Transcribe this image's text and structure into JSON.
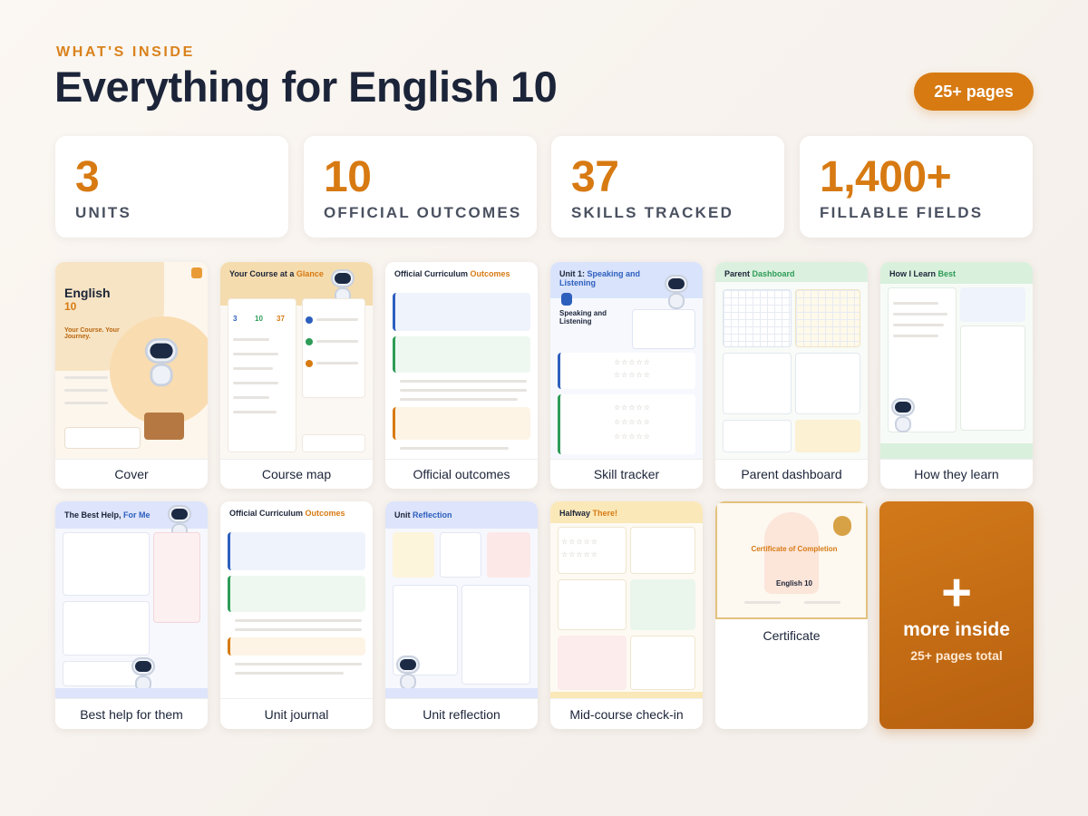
{
  "header": {
    "eyebrow": "WHAT'S INSIDE",
    "title": "Everything for English 10",
    "pages_badge": "25+ pages"
  },
  "stats": [
    {
      "value": "3",
      "label": "UNITS"
    },
    {
      "value": "10",
      "label": "OFFICIAL OUTCOMES"
    },
    {
      "value": "37",
      "label": "SKILLS TRACKED"
    },
    {
      "value": "1,400+",
      "label": "FILLABLE FIELDS"
    }
  ],
  "pages": [
    {
      "caption": "Cover",
      "preview": {
        "title": "English",
        "subtitle": "10",
        "tagline": "Your Course. Your Journey."
      }
    },
    {
      "caption": "Course map",
      "preview": {
        "title": "Your Course at a",
        "accent": "Glance",
        "nums": [
          "3",
          "10",
          "37"
        ]
      }
    },
    {
      "caption": "Official outcomes",
      "preview": {
        "title": "Official Curriculum",
        "accent": "Outcomes"
      }
    },
    {
      "caption": "Skill tracker",
      "preview": {
        "title": "Unit 1:",
        "accent": "Speaking and Listening",
        "section": "Speaking and Listening"
      }
    },
    {
      "caption": "Parent dashboard",
      "preview": {
        "title": "Parent",
        "accent": "Dashboard"
      }
    },
    {
      "caption": "How they learn",
      "preview": {
        "title": "How I Learn",
        "accent": "Best"
      }
    },
    {
      "caption": "Best help for them",
      "preview": {
        "title": "The Best Help,",
        "accent": "For Me"
      }
    },
    {
      "caption": "Unit journal",
      "preview": {
        "title": "Official Curriculum",
        "accent": "Outcomes"
      }
    },
    {
      "caption": "Unit reflection",
      "preview": {
        "title": "Unit",
        "accent": "Reflection"
      }
    },
    {
      "caption": "Mid-course check-in",
      "preview": {
        "title": "Halfway",
        "accent": "There!"
      }
    },
    {
      "caption": "Certificate",
      "preview": {
        "title": "Certificate of Completion",
        "subtitle": "English 10"
      }
    }
  ],
  "more_card": {
    "plus": "+",
    "line1": "more inside",
    "line2": "25+ pages total"
  },
  "colors": {
    "accent": "#d77a12",
    "navy": "#1b2438",
    "muted": "#4a5160"
  }
}
